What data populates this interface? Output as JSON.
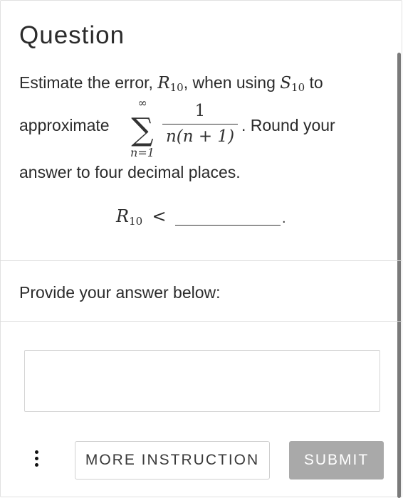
{
  "question": {
    "title": "Question",
    "line1": {
      "pre": "Estimate the error, ",
      "r_symbol": "R",
      "r_sub": "10",
      "mid": ", when using ",
      "s_symbol": "S",
      "s_sub": "10",
      "post": " to"
    },
    "line2": {
      "pre": "approximate ",
      "sigma_top": "∞",
      "sigma": "∑",
      "sigma_bottom": "n=1",
      "numerator": "1",
      "denominator": "n(n + 1)",
      "post": ". Round your"
    },
    "line3": "answer to four decimal places.",
    "inequality": {
      "symbol": "R",
      "sub": "10",
      "op": "<",
      "end": "."
    }
  },
  "answer": {
    "prompt": "Provide your answer below:",
    "value": ""
  },
  "footer": {
    "more_label": "MORE INSTRUCTION",
    "submit_label": "SUBMIT"
  },
  "colors": {
    "submit_bg": "#a9a9a9",
    "border": "#dcdcdc"
  }
}
